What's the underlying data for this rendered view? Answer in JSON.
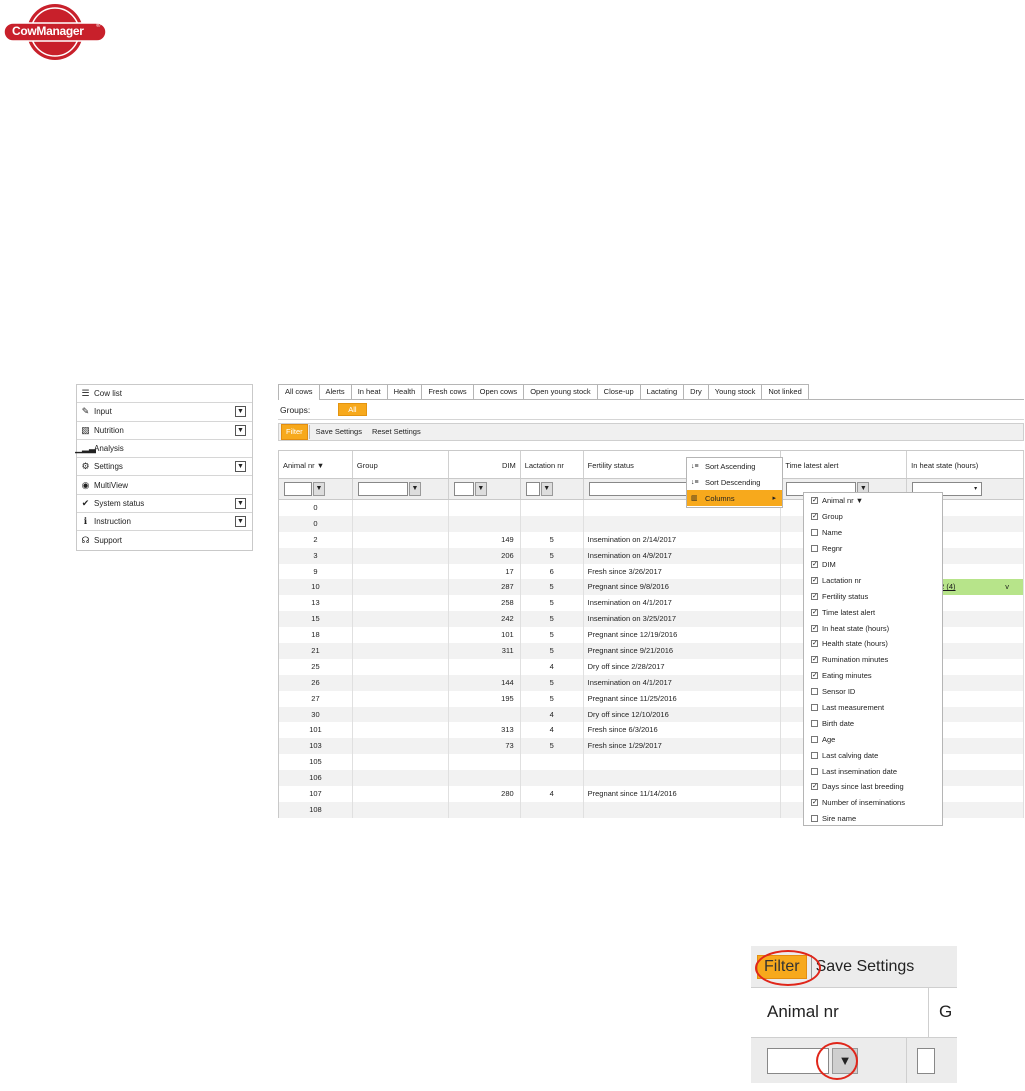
{
  "logo": {
    "text": "CowManager",
    "reg": "®"
  },
  "menu": [
    {
      "label": "Cow list",
      "icon": "list-icon",
      "glyph": "☰",
      "expand": false
    },
    {
      "label": "Input",
      "icon": "pencil-icon",
      "glyph": "✎",
      "expand": true
    },
    {
      "label": "Nutrition",
      "icon": "nutrition-icon",
      "glyph": "▧",
      "expand": true
    },
    {
      "label": "Analysis",
      "icon": "bar-chart-icon",
      "glyph": "▁▂▃",
      "expand": false
    },
    {
      "label": "Settings",
      "icon": "gear-icon",
      "glyph": "⚙",
      "expand": true
    },
    {
      "label": "MultiView",
      "icon": "eye-icon",
      "glyph": "◉",
      "expand": false
    },
    {
      "label": "System status",
      "icon": "check-icon",
      "glyph": "✔",
      "expand": true
    },
    {
      "label": "Instruction",
      "icon": "info-icon",
      "glyph": "ℹ",
      "expand": true
    },
    {
      "label": "Support",
      "icon": "headset-icon",
      "glyph": "☊",
      "expand": false
    }
  ],
  "tabs": [
    "All cows",
    "Alerts",
    "In heat",
    "Health",
    "Fresh cows",
    "Open cows",
    "Open young stock",
    "Close-up",
    "Lactating",
    "Dry",
    "Young stock",
    "Not linked"
  ],
  "groups": {
    "label": "Groups:",
    "all": "All"
  },
  "toolbar": {
    "filter": "Filter",
    "save": "Save Settings",
    "reset": "Reset Settings"
  },
  "columns": [
    "Animal nr ▼",
    "Group",
    "DIM",
    "Lactation nr",
    "Fertility status",
    "Time latest alert",
    "In heat state (hours)"
  ],
  "rows": [
    {
      "nr": "0",
      "dim": "",
      "lac": "",
      "fert": ""
    },
    {
      "nr": "0",
      "dim": "",
      "lac": "",
      "fert": ""
    },
    {
      "nr": "2",
      "dim": "149",
      "lac": "5",
      "fert": "Insemination on 2/14/2017"
    },
    {
      "nr": "3",
      "dim": "206",
      "lac": "5",
      "fert": "Insemination on 4/9/2017"
    },
    {
      "nr": "9",
      "dim": "17",
      "lac": "6",
      "fert": "Fresh since 3/26/2017"
    },
    {
      "nr": "10",
      "dim": "287",
      "lac": "5",
      "fert": "Pregnant since 9/8/2016"
    },
    {
      "nr": "13",
      "dim": "258",
      "lac": "5",
      "fert": "Insemination on 4/1/2017"
    },
    {
      "nr": "15",
      "dim": "242",
      "lac": "5",
      "fert": "Insemination on 3/25/2017"
    },
    {
      "nr": "18",
      "dim": "101",
      "lac": "5",
      "fert": "Pregnant since 12/19/2016"
    },
    {
      "nr": "21",
      "dim": "311",
      "lac": "5",
      "fert": "Pregnant since 9/21/2016"
    },
    {
      "nr": "25",
      "dim": "",
      "lac": "4",
      "fert": "Dry off since 2/28/2017"
    },
    {
      "nr": "26",
      "dim": "144",
      "lac": "5",
      "fert": "Insemination on 4/1/2017"
    },
    {
      "nr": "27",
      "dim": "195",
      "lac": "5",
      "fert": "Pregnant since 11/25/2016"
    },
    {
      "nr": "30",
      "dim": "",
      "lac": "4",
      "fert": "Dry off since 12/10/2016"
    },
    {
      "nr": "101",
      "dim": "313",
      "lac": "4",
      "fert": "Fresh since 6/3/2016"
    },
    {
      "nr": "103",
      "dim": "73",
      "lac": "5",
      "fert": "Fresh since 1/29/2017"
    },
    {
      "nr": "105",
      "dim": "",
      "lac": "",
      "fert": ""
    },
    {
      "nr": "106",
      "dim": "",
      "lac": "",
      "fert": ""
    },
    {
      "nr": "107",
      "dim": "280",
      "lac": "4",
      "fert": "Pregnant since 11/14/2016"
    },
    {
      "nr": "108",
      "dim": "",
      "lac": "",
      "fert": ""
    }
  ],
  "heat_cell": {
    "row": 5,
    "text": "3.1 / 3.2 (4)",
    "suffix": "v"
  },
  "context_menu": {
    "sort_asc": "Sort Ascending",
    "sort_desc": "Sort Descending",
    "columns": "Columns"
  },
  "column_picker": [
    {
      "label": "Animal nr ▼",
      "checked": true
    },
    {
      "label": "Group",
      "checked": true
    },
    {
      "label": "Name",
      "checked": false
    },
    {
      "label": "Regnr",
      "checked": false
    },
    {
      "label": "DIM",
      "checked": true
    },
    {
      "label": "Lactation nr",
      "checked": true
    },
    {
      "label": "Fertility status",
      "checked": true
    },
    {
      "label": "Time latest alert",
      "checked": true
    },
    {
      "label": "In heat state (hours)",
      "checked": true
    },
    {
      "label": "Health state (hours)",
      "checked": true
    },
    {
      "label": "Rumination minutes",
      "checked": true
    },
    {
      "label": "Eating minutes",
      "checked": true
    },
    {
      "label": "Sensor ID",
      "checked": false
    },
    {
      "label": "Last measurement",
      "checked": false
    },
    {
      "label": "Birth date",
      "checked": false
    },
    {
      "label": "Age",
      "checked": false
    },
    {
      "label": "Last calving date",
      "checked": false
    },
    {
      "label": "Last insemination date",
      "checked": false
    },
    {
      "label": "Days since last breeding",
      "checked": true
    },
    {
      "label": "Number of inseminations",
      "checked": true
    },
    {
      "label": "Sire name",
      "checked": false
    }
  ],
  "inset": {
    "filter": "Filter",
    "save": "Save Settings",
    "col1": "Animal nr",
    "col2": "G"
  },
  "colors": {
    "accent": "#f7a91c",
    "brand": "#c8202b",
    "highlight_ring": "#e0261a",
    "heat_cell": "#b7e48a"
  }
}
